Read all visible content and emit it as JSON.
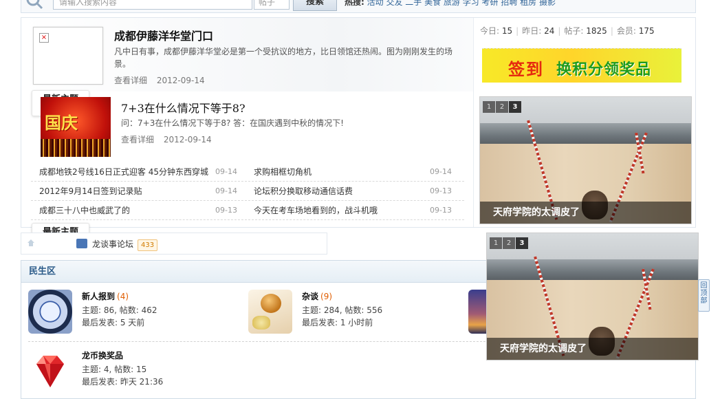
{
  "search": {
    "placeholder": "请输入搜索内容",
    "select_value": "帖子",
    "button_label": "搜索",
    "hot_label": "热搜:",
    "hot_words": "活动 交友 二手 美食 旅游 学习 考研 招聘 租房 摄影"
  },
  "features": [
    {
      "title": "成都伊藤洋华堂门口",
      "summary": "凡中日有事，成都伊藤洋华堂必是第一个受抗议的地方，比日领馆还热闹。图为刚刚发生的场景。",
      "detail_label": "查看详细",
      "date": "2012-09-14"
    },
    {
      "title": "7+3在什么情况下等于8?",
      "summary": "问：7+3在什么情况下等于8? 答：在国庆遇到中秋的情况下!",
      "detail_label": "查看详细",
      "date": "2012-09-14",
      "image_text": "国庆"
    }
  ],
  "badges": {
    "new_topics": "最新主题"
  },
  "news": [
    {
      "left": {
        "title": "成都地铁2号线16日正式迎客 45分钟东西穿城",
        "date": "09-14"
      },
      "right": {
        "title": "求购相框切角机",
        "date": "09-14"
      }
    },
    {
      "left": {
        "title": "2012年9月14日签到记录贴",
        "date": "09-14"
      },
      "right": {
        "title": "论坛积分换取移动通信话费",
        "date": "09-13"
      }
    },
    {
      "left": {
        "title": "成都三十八中也威武了的",
        "date": "09-13"
      },
      "right": {
        "title": "今天在考车场地看到的，战斗机哦",
        "date": "09-13"
      }
    }
  ],
  "stats": {
    "today_label": "今日:",
    "today": "15",
    "yesterday_label": "昨日:",
    "yesterday": "24",
    "posts_label": "帖子:",
    "posts": "1825",
    "members_label": "会员:",
    "members": "175"
  },
  "sign_banner": {
    "part1": "签到",
    "part2": "换积分领奖品"
  },
  "slideshow": {
    "numbers": [
      "1",
      "2",
      "3"
    ],
    "active": "3",
    "caption": "天府学院的太调皮了"
  },
  "forum_nav": {
    "crumb": "龙谈事论坛",
    "count": "433"
  },
  "board": {
    "title": "民生区",
    "forums": [
      {
        "name": "新人报到",
        "count": "(4)",
        "stats": "主题: 86, 帖数: 462",
        "last": "最后发表: 5 天前",
        "icon": "compass-icon"
      },
      {
        "name": "杂谈",
        "count": "(9)",
        "stats": "主题: 284, 帖数: 556",
        "last": "最后发表: 1 小时前",
        "icon": "teapot-icon"
      },
      {
        "name": "龙币换奖品",
        "count": "",
        "stats": "主题: 4, 帖数: 15",
        "last": "最后发表: 昨天 21:36",
        "icon": "ruby-icon"
      }
    ]
  },
  "back_top": {
    "label": "回顶部"
  }
}
